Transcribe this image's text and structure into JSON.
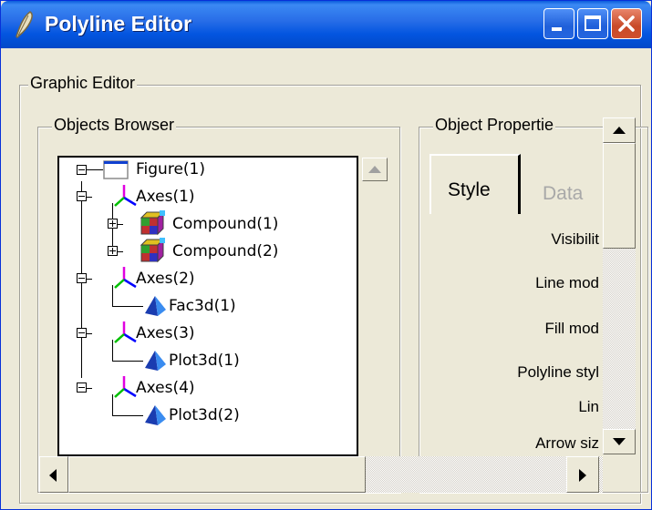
{
  "window": {
    "title": "Polyline Editor",
    "controls": {
      "minimize": "minimize",
      "maximize": "maximize",
      "close": "close"
    }
  },
  "graphic_editor": {
    "label": "Graphic Editor",
    "objects_browser": {
      "label": "Objects Browser",
      "tree": [
        {
          "label": "Figure(1)",
          "icon": "figure-icon",
          "expander": "minus"
        },
        {
          "label": "Axes(1)",
          "icon": "axes-icon",
          "expander": "minus"
        },
        {
          "label": "Compound(1)",
          "icon": "compound-icon",
          "expander": "plus"
        },
        {
          "label": "Compound(2)",
          "icon": "compound-icon",
          "expander": "plus"
        },
        {
          "label": "Axes(2)",
          "icon": "axes-icon",
          "expander": "minus"
        },
        {
          "label": "Fac3d(1)",
          "icon": "surface-icon",
          "expander": "none"
        },
        {
          "label": "Axes(3)",
          "icon": "axes-icon",
          "expander": "minus"
        },
        {
          "label": "Plot3d(1)",
          "icon": "surface-icon",
          "expander": "none"
        },
        {
          "label": "Axes(4)",
          "icon": "axes-icon",
          "expander": "minus"
        },
        {
          "label": "Plot3d(2)",
          "icon": "surface-icon",
          "expander": "none"
        }
      ]
    },
    "object_properties": {
      "label": "Object Propertie",
      "tabs": [
        {
          "label": "Style",
          "active": true
        },
        {
          "label": "Data",
          "active": false
        }
      ],
      "fields": [
        "Visibilit",
        "Line mod",
        "Fill mod",
        "Polyline styl",
        "Lin",
        "Arrow siz"
      ]
    }
  },
  "colors": {
    "titlebar": "#0355e0",
    "window_bg": "#ece9d8",
    "close_button": "#d0502e",
    "axes_x": "#00c000",
    "axes_y": "#e000e0",
    "axes_z": "#0000ff",
    "surface": "#1a4bd0"
  }
}
